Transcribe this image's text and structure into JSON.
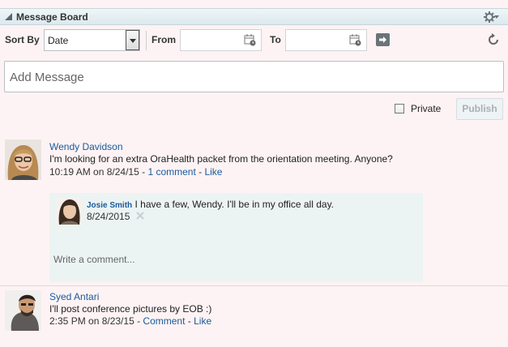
{
  "header": {
    "title": "Message Board",
    "settings_icon": "gear-icon"
  },
  "toolbar": {
    "sort_label": "Sort By",
    "sort_value": "Date",
    "from_label": "From",
    "to_label": "To",
    "from_value": "",
    "to_value": ""
  },
  "composer": {
    "placeholder": "Add Message",
    "private_label": "Private",
    "publish_label": "Publish"
  },
  "posts": [
    {
      "author": "Wendy Davidson",
      "text": "I'm looking for an extra OraHealth packet from the orientation meeting. Anyone?",
      "time": "10:19 AM on 8/24/15",
      "comments_link": "1 comment",
      "like_link": "Like",
      "sep": " - ",
      "reply": {
        "author": "Josie Smith",
        "text": "I have a few, Wendy. I'll be in my office all day.",
        "date": "8/24/2015"
      },
      "comment_placeholder": "Write a comment..."
    },
    {
      "author": "Syed Antari",
      "text": "I'll post conference pictures by EOB :)",
      "time": "2:35 PM on 8/23/15",
      "comments_link": "Comment",
      "like_link": "Like",
      "sep": " - "
    }
  ],
  "colors": {
    "link": "#1a5a9a",
    "background": "#fdf3f4",
    "reply_bg": "#ecf3f3"
  }
}
